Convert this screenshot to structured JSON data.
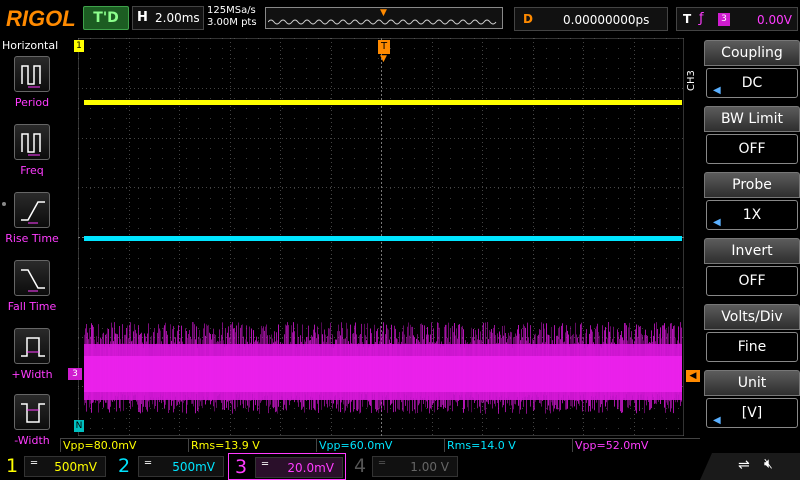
{
  "brand": "RIGOL",
  "top": {
    "trigger_status": "T'D",
    "h_label": "H",
    "timebase": "2.00ms",
    "sample_rate": "125MSa/s",
    "memory_depth": "3.00M pts",
    "delay_label": "D",
    "delay_value": "0.00000000ps",
    "trigger_label": "T",
    "trigger_edge": "ƒ",
    "trigger_source": "3",
    "trigger_level": "0.00V"
  },
  "left_panel": {
    "title": "Horizontal",
    "items": [
      {
        "label": "Period",
        "icon": "period-icon"
      },
      {
        "label": "Freq",
        "icon": "freq-icon"
      },
      {
        "label": "Rise Time",
        "icon": "rise-time-icon"
      },
      {
        "label": "Fall Time",
        "icon": "fall-time-icon"
      },
      {
        "label": "+Width",
        "icon": "pos-width-icon"
      },
      {
        "label": "-Width",
        "icon": "neg-width-icon"
      }
    ]
  },
  "right_menu": {
    "channel_tag": "CH3",
    "items": [
      {
        "title": "Coupling",
        "value": "DC",
        "has_arrow": true
      },
      {
        "title": "BW Limit",
        "value": "OFF",
        "has_arrow": false
      },
      {
        "title": "Probe",
        "value": "1X",
        "has_arrow": true
      },
      {
        "title": "Invert",
        "value": "OFF",
        "has_arrow": false
      },
      {
        "title": "Volts/Div",
        "value": "Fine",
        "has_arrow": false
      },
      {
        "title": "Unit",
        "value": "[V]",
        "has_arrow": true
      }
    ]
  },
  "markers": {
    "ch1": "1",
    "ch3": "3",
    "trigger_top": "T",
    "n": "N"
  },
  "measurements": [
    {
      "text": "Vpp=80.0mV",
      "color": "#ffff00"
    },
    {
      "text": "Rms=13.9 V",
      "color": "#ffff00"
    },
    {
      "text": "Vpp=60.0mV",
      "color": "#00e5ff"
    },
    {
      "text": "Rms=14.0 V",
      "color": "#00e5ff"
    },
    {
      "text": "Vpp=52.0mV",
      "color": "#ff3cff"
    }
  ],
  "channels": [
    {
      "num": "1",
      "scale": "500mV",
      "color": "#ffff00",
      "active": true
    },
    {
      "num": "2",
      "scale": "500mV",
      "color": "#00e5ff",
      "active": true
    },
    {
      "num": "3",
      "scale": "20.0mV",
      "color": "#ff3cff",
      "active": true
    },
    {
      "num": "4",
      "scale": "1.00 V",
      "color": "#555555",
      "active": false
    }
  ],
  "coupling_glyph": "═",
  "colors": {
    "ch1": "#ffff00",
    "ch2": "#00e5ff",
    "ch3": "#ff3cff",
    "trigger": "#ff8a00",
    "grid": "#555555"
  }
}
